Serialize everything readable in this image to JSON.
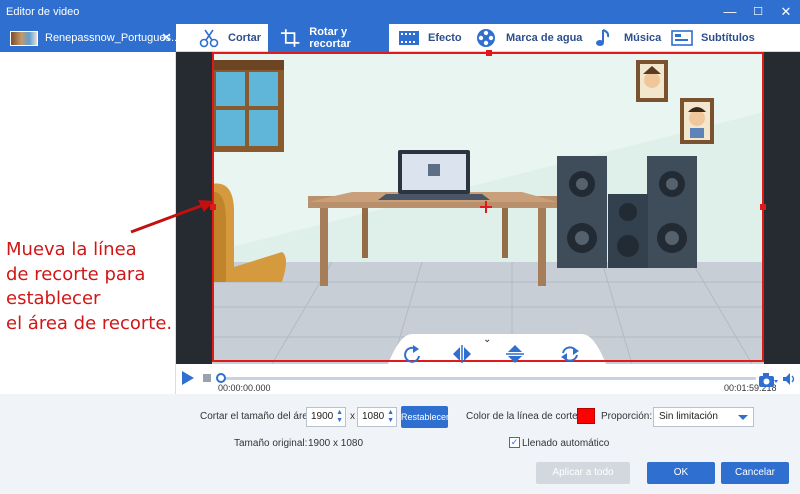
{
  "window": {
    "title": "Editor de video",
    "minimize_glyph": "—",
    "maximize_glyph": "☐",
    "close_glyph": "✕"
  },
  "file_list": {
    "items": [
      {
        "name": "Renepassnow_Portugues...",
        "close_glyph": "✕"
      }
    ]
  },
  "tabs": [
    {
      "label": "Cortar",
      "icon": "scissors-icon",
      "active": false
    },
    {
      "label": "Rotar y recortar",
      "icon": "crop-icon",
      "active": true
    },
    {
      "label": "Efecto",
      "icon": "film-icon",
      "active": false
    },
    {
      "label": "Marca de agua",
      "icon": "film-reel-icon",
      "active": false
    },
    {
      "label": "Música",
      "icon": "music-note-icon",
      "active": false
    },
    {
      "label": "Subtítulos",
      "icon": "subtitles-icon",
      "active": false
    }
  ],
  "annotation": {
    "lines": [
      "Mueva la línea",
      "de recorte para",
      "establecer",
      "el área de recorte."
    ],
    "color": "#d01616"
  },
  "preview_controls": [
    {
      "name": "rotate-clockwise",
      "icon": "rotate-icon"
    },
    {
      "name": "flip-horizontal",
      "icon": "flip-horizontal-icon"
    },
    {
      "name": "flip-vertical",
      "icon": "flip-vertical-icon"
    },
    {
      "name": "reset-rotation",
      "icon": "refresh-icon"
    }
  ],
  "timeline": {
    "current_time": "00:00:00.000",
    "total_time": "00:01:59.218",
    "progress": 0.0
  },
  "settings": {
    "crop_area_label": "Cortar el tamaño del área:",
    "width_value": "1900",
    "x_separator": "x",
    "height_value": "1080",
    "reset_label": "Restablecer",
    "crop_line_color_label": "Color de la línea de corte:",
    "crop_line_color": "#ff0000",
    "ratio_label": "Proporción:",
    "ratio_value": "Sin limitación",
    "original_size_label": "Tamaño original:",
    "original_size_value": "1900 x 1080",
    "auto_fill_label": "Llenado automático",
    "auto_fill_checked": true
  },
  "footer": {
    "apply_all_label": "Aplicar a todo",
    "ok_label": "OK",
    "cancel_label": "Cancelar"
  },
  "colors": {
    "accent": "#2f6fd0",
    "crop_frame": "#e01a1a"
  }
}
